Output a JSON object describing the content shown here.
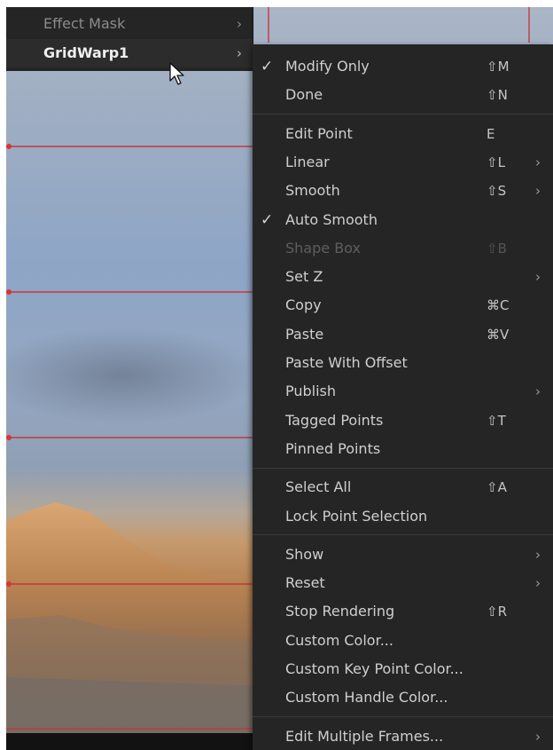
{
  "left_menu": {
    "items": [
      {
        "label": "Effect Mask",
        "has_submenu": true
      },
      {
        "label": "GridWarp1",
        "has_submenu": true
      }
    ]
  },
  "context_menu": {
    "items": [
      {
        "label": "Modify Only",
        "shortcut": "⇧M",
        "checked": true,
        "submenu": false,
        "disabled": false
      },
      {
        "label": "Done",
        "shortcut": "⇧N",
        "checked": false,
        "submenu": false,
        "disabled": false
      },
      {
        "label": "Edit Point",
        "shortcut": "E",
        "checked": false,
        "submenu": false,
        "disabled": false
      },
      {
        "label": "Linear",
        "shortcut": "⇧L",
        "checked": false,
        "submenu": true,
        "disabled": false
      },
      {
        "label": "Smooth",
        "shortcut": "⇧S",
        "checked": false,
        "submenu": true,
        "disabled": false
      },
      {
        "label": "Auto Smooth",
        "shortcut": "",
        "checked": true,
        "submenu": false,
        "disabled": false
      },
      {
        "label": "Shape Box",
        "shortcut": "⇧B",
        "checked": false,
        "submenu": false,
        "disabled": true
      },
      {
        "label": "Set Z",
        "shortcut": "",
        "checked": false,
        "submenu": true,
        "disabled": false
      },
      {
        "label": "Copy",
        "shortcut": "⌘C",
        "checked": false,
        "submenu": false,
        "disabled": false
      },
      {
        "label": "Paste",
        "shortcut": "⌘V",
        "checked": false,
        "submenu": false,
        "disabled": false
      },
      {
        "label": "Paste With Offset",
        "shortcut": "",
        "checked": false,
        "submenu": false,
        "disabled": false
      },
      {
        "label": "Publish",
        "shortcut": "",
        "checked": false,
        "submenu": true,
        "disabled": false
      },
      {
        "label": "Tagged Points",
        "shortcut": "⇧T",
        "checked": false,
        "submenu": false,
        "disabled": false
      },
      {
        "label": "Pinned Points",
        "shortcut": "",
        "checked": false,
        "submenu": false,
        "disabled": false
      },
      {
        "label": "Select All",
        "shortcut": "⇧A",
        "checked": false,
        "submenu": false,
        "disabled": false
      },
      {
        "label": "Lock Point Selection",
        "shortcut": "",
        "checked": false,
        "submenu": false,
        "disabled": false
      },
      {
        "label": "Show",
        "shortcut": "",
        "checked": false,
        "submenu": true,
        "disabled": false
      },
      {
        "label": "Reset",
        "shortcut": "",
        "checked": false,
        "submenu": true,
        "disabled": false
      },
      {
        "label": "Stop Rendering",
        "shortcut": "⇧R",
        "checked": false,
        "submenu": false,
        "disabled": false
      },
      {
        "label": "Custom Color...",
        "shortcut": "",
        "checked": false,
        "submenu": false,
        "disabled": false
      },
      {
        "label": "Custom Key Point Color...",
        "shortcut": "",
        "checked": false,
        "submenu": false,
        "disabled": false
      },
      {
        "label": "Custom Handle Color...",
        "shortcut": "",
        "checked": false,
        "submenu": false,
        "disabled": false
      },
      {
        "label": "Edit Multiple Frames...",
        "shortcut": "",
        "checked": false,
        "submenu": true,
        "disabled": false
      }
    ]
  },
  "glyphs": {
    "check": "✓",
    "submenu_arrow": "›"
  },
  "colors": {
    "menu_bg": "#252525",
    "grid_line": "#c0392b",
    "text": "#cfcfcf",
    "disabled_text": "#5e5e5e"
  }
}
